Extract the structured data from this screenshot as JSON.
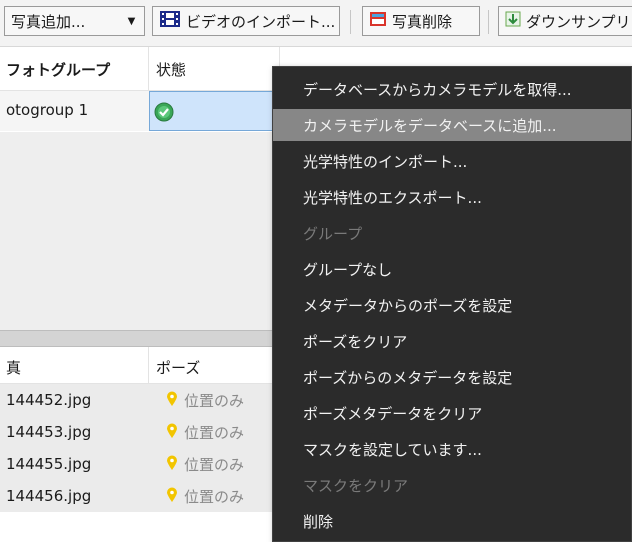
{
  "toolbar": {
    "add_photos": "写真追加...",
    "import_video": "ビデオのインポート...",
    "delete_photos": "写真削除",
    "downsample": "ダウンサンプリ"
  },
  "photogroups": {
    "columns": [
      "フォトグループ",
      "状態"
    ],
    "rows": [
      {
        "name": "otogroup 1",
        "status_icon": "check-icon"
      }
    ]
  },
  "photos": {
    "columns": [
      "真",
      "ポーズ"
    ],
    "rows": [
      {
        "file": "144452.jpg",
        "pose": "位置のみ"
      },
      {
        "file": "144453.jpg",
        "pose": "位置のみ"
      },
      {
        "file": "144455.jpg",
        "pose": "位置のみ"
      },
      {
        "file": "144456.jpg",
        "pose": "位置のみ"
      }
    ]
  },
  "context_menu": {
    "items": [
      {
        "label": "データベースからカメラモデルを取得...",
        "state": "normal"
      },
      {
        "label": "カメラモデルをデータベースに追加...",
        "state": "highlighted"
      },
      {
        "label": "光学特性のインポート...",
        "state": "normal"
      },
      {
        "label": "光学特性のエクスポート...",
        "state": "normal"
      },
      {
        "label": "グループ",
        "state": "disabled"
      },
      {
        "label": "グループなし",
        "state": "normal"
      },
      {
        "label": "メタデータからのポーズを設定",
        "state": "normal"
      },
      {
        "label": "ポーズをクリア",
        "state": "normal"
      },
      {
        "label": "ポーズからのメタデータを設定",
        "state": "normal"
      },
      {
        "label": "ポーズメタデータをクリア",
        "state": "normal"
      },
      {
        "label": "マスクを設定しています...",
        "state": "normal"
      },
      {
        "label": "マスクをクリア",
        "state": "disabled"
      },
      {
        "label": "削除",
        "state": "normal"
      }
    ]
  },
  "colors": {
    "menu_bg": "#2b2b2b",
    "menu_highlight": "#878787",
    "pose_pin": "#f2c500",
    "check_green": "#3aa657"
  }
}
